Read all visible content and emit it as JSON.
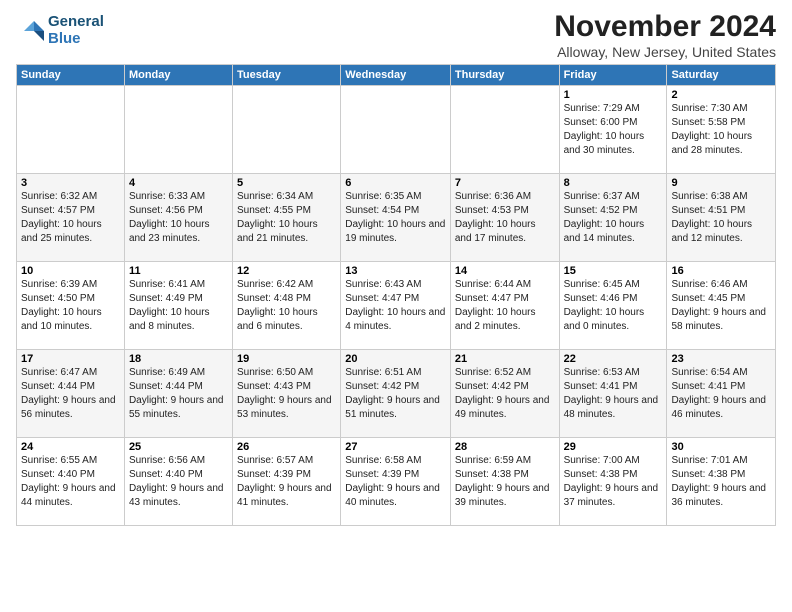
{
  "header": {
    "logo_line1": "General",
    "logo_line2": "Blue",
    "title": "November 2024",
    "location": "Alloway, New Jersey, United States"
  },
  "days_of_week": [
    "Sunday",
    "Monday",
    "Tuesday",
    "Wednesday",
    "Thursday",
    "Friday",
    "Saturday"
  ],
  "weeks": [
    [
      {
        "day": "",
        "info": ""
      },
      {
        "day": "",
        "info": ""
      },
      {
        "day": "",
        "info": ""
      },
      {
        "day": "",
        "info": ""
      },
      {
        "day": "",
        "info": ""
      },
      {
        "day": "1",
        "info": "Sunrise: 7:29 AM\nSunset: 6:00 PM\nDaylight: 10 hours and 30 minutes."
      },
      {
        "day": "2",
        "info": "Sunrise: 7:30 AM\nSunset: 5:58 PM\nDaylight: 10 hours and 28 minutes."
      }
    ],
    [
      {
        "day": "3",
        "info": "Sunrise: 6:32 AM\nSunset: 4:57 PM\nDaylight: 10 hours and 25 minutes."
      },
      {
        "day": "4",
        "info": "Sunrise: 6:33 AM\nSunset: 4:56 PM\nDaylight: 10 hours and 23 minutes."
      },
      {
        "day": "5",
        "info": "Sunrise: 6:34 AM\nSunset: 4:55 PM\nDaylight: 10 hours and 21 minutes."
      },
      {
        "day": "6",
        "info": "Sunrise: 6:35 AM\nSunset: 4:54 PM\nDaylight: 10 hours and 19 minutes."
      },
      {
        "day": "7",
        "info": "Sunrise: 6:36 AM\nSunset: 4:53 PM\nDaylight: 10 hours and 17 minutes."
      },
      {
        "day": "8",
        "info": "Sunrise: 6:37 AM\nSunset: 4:52 PM\nDaylight: 10 hours and 14 minutes."
      },
      {
        "day": "9",
        "info": "Sunrise: 6:38 AM\nSunset: 4:51 PM\nDaylight: 10 hours and 12 minutes."
      }
    ],
    [
      {
        "day": "10",
        "info": "Sunrise: 6:39 AM\nSunset: 4:50 PM\nDaylight: 10 hours and 10 minutes."
      },
      {
        "day": "11",
        "info": "Sunrise: 6:41 AM\nSunset: 4:49 PM\nDaylight: 10 hours and 8 minutes."
      },
      {
        "day": "12",
        "info": "Sunrise: 6:42 AM\nSunset: 4:48 PM\nDaylight: 10 hours and 6 minutes."
      },
      {
        "day": "13",
        "info": "Sunrise: 6:43 AM\nSunset: 4:47 PM\nDaylight: 10 hours and 4 minutes."
      },
      {
        "day": "14",
        "info": "Sunrise: 6:44 AM\nSunset: 4:47 PM\nDaylight: 10 hours and 2 minutes."
      },
      {
        "day": "15",
        "info": "Sunrise: 6:45 AM\nSunset: 4:46 PM\nDaylight: 10 hours and 0 minutes."
      },
      {
        "day": "16",
        "info": "Sunrise: 6:46 AM\nSunset: 4:45 PM\nDaylight: 9 hours and 58 minutes."
      }
    ],
    [
      {
        "day": "17",
        "info": "Sunrise: 6:47 AM\nSunset: 4:44 PM\nDaylight: 9 hours and 56 minutes."
      },
      {
        "day": "18",
        "info": "Sunrise: 6:49 AM\nSunset: 4:44 PM\nDaylight: 9 hours and 55 minutes."
      },
      {
        "day": "19",
        "info": "Sunrise: 6:50 AM\nSunset: 4:43 PM\nDaylight: 9 hours and 53 minutes."
      },
      {
        "day": "20",
        "info": "Sunrise: 6:51 AM\nSunset: 4:42 PM\nDaylight: 9 hours and 51 minutes."
      },
      {
        "day": "21",
        "info": "Sunrise: 6:52 AM\nSunset: 4:42 PM\nDaylight: 9 hours and 49 minutes."
      },
      {
        "day": "22",
        "info": "Sunrise: 6:53 AM\nSunset: 4:41 PM\nDaylight: 9 hours and 48 minutes."
      },
      {
        "day": "23",
        "info": "Sunrise: 6:54 AM\nSunset: 4:41 PM\nDaylight: 9 hours and 46 minutes."
      }
    ],
    [
      {
        "day": "24",
        "info": "Sunrise: 6:55 AM\nSunset: 4:40 PM\nDaylight: 9 hours and 44 minutes."
      },
      {
        "day": "25",
        "info": "Sunrise: 6:56 AM\nSunset: 4:40 PM\nDaylight: 9 hours and 43 minutes."
      },
      {
        "day": "26",
        "info": "Sunrise: 6:57 AM\nSunset: 4:39 PM\nDaylight: 9 hours and 41 minutes."
      },
      {
        "day": "27",
        "info": "Sunrise: 6:58 AM\nSunset: 4:39 PM\nDaylight: 9 hours and 40 minutes."
      },
      {
        "day": "28",
        "info": "Sunrise: 6:59 AM\nSunset: 4:38 PM\nDaylight: 9 hours and 39 minutes."
      },
      {
        "day": "29",
        "info": "Sunrise: 7:00 AM\nSunset: 4:38 PM\nDaylight: 9 hours and 37 minutes."
      },
      {
        "day": "30",
        "info": "Sunrise: 7:01 AM\nSunset: 4:38 PM\nDaylight: 9 hours and 36 minutes."
      }
    ]
  ]
}
